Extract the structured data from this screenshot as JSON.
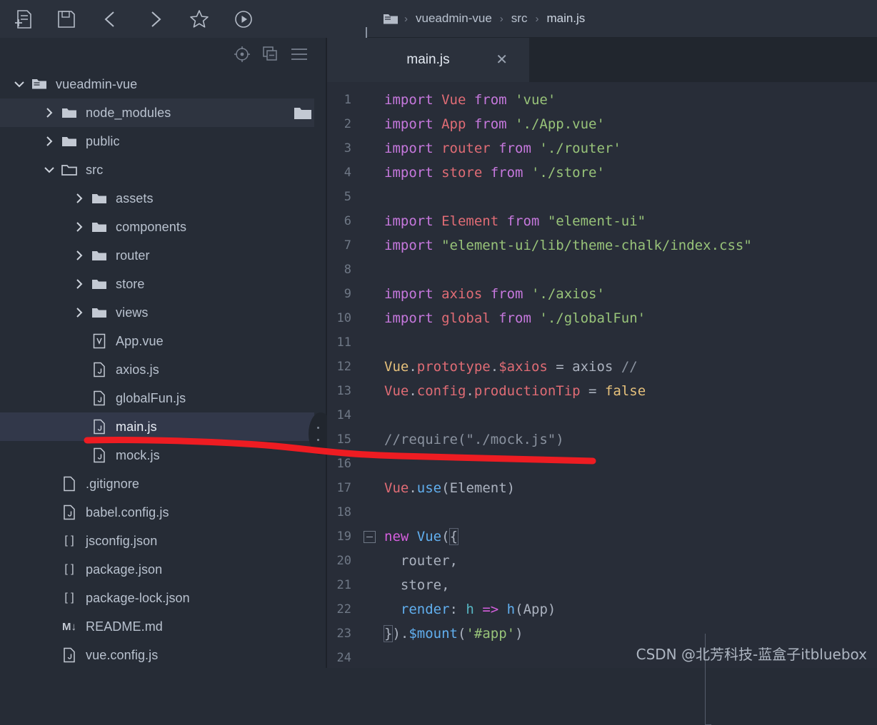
{
  "toolbar": {
    "buttons": [
      {
        "name": "new-file-icon",
        "label": "New File"
      },
      {
        "name": "save-icon",
        "label": "Save"
      },
      {
        "name": "back-arrow-icon",
        "label": "Back"
      },
      {
        "name": "forward-arrow-icon",
        "label": "Forward"
      },
      {
        "name": "star-icon",
        "label": "Bookmark"
      },
      {
        "name": "run-icon",
        "label": "Run"
      }
    ]
  },
  "breadcrumb": {
    "folder_icon": "folder-icon",
    "separator": "›",
    "items": [
      "vueadmin-vue",
      "src",
      "main.js"
    ]
  },
  "sidebar": {
    "tools": [
      {
        "name": "locate-target-icon"
      },
      {
        "name": "collapse-all-icon"
      },
      {
        "name": "menu-icon"
      }
    ],
    "tree": [
      {
        "label": "vueadmin-vue",
        "indent": 0,
        "arrow": "down",
        "icon": "project-folder-icon",
        "state": "normal"
      },
      {
        "label": "node_modules",
        "indent": 1,
        "arrow": "right",
        "icon": "folder-icon",
        "state": "selected",
        "trailing_icon": "folder-icon"
      },
      {
        "label": "public",
        "indent": 1,
        "arrow": "right",
        "icon": "folder-icon",
        "state": "normal"
      },
      {
        "label": "src",
        "indent": 1,
        "arrow": "down",
        "icon": "folder-open-icon",
        "state": "normal"
      },
      {
        "label": "assets",
        "indent": 2,
        "arrow": "right",
        "icon": "folder-icon",
        "state": "normal"
      },
      {
        "label": "components",
        "indent": 2,
        "arrow": "right",
        "icon": "folder-icon",
        "state": "normal"
      },
      {
        "label": "router",
        "indent": 2,
        "arrow": "right",
        "icon": "folder-icon",
        "state": "normal"
      },
      {
        "label": "store",
        "indent": 2,
        "arrow": "right",
        "icon": "folder-icon",
        "state": "normal"
      },
      {
        "label": "views",
        "indent": 2,
        "arrow": "right",
        "icon": "folder-icon",
        "state": "normal"
      },
      {
        "label": "App.vue",
        "indent": 2,
        "arrow": "none",
        "icon": "vue-file-icon",
        "state": "normal"
      },
      {
        "label": "axios.js",
        "indent": 2,
        "arrow": "none",
        "icon": "js-file-icon",
        "state": "normal"
      },
      {
        "label": "globalFun.js",
        "indent": 2,
        "arrow": "none",
        "icon": "js-file-icon",
        "state": "normal"
      },
      {
        "label": "main.js",
        "indent": 2,
        "arrow": "none",
        "icon": "js-file-icon",
        "state": "active"
      },
      {
        "label": "mock.js",
        "indent": 2,
        "arrow": "none",
        "icon": "js-file-icon",
        "state": "normal"
      },
      {
        "label": ".gitignore",
        "indent": 1,
        "arrow": "none",
        "icon": "plain-file-icon",
        "state": "normal"
      },
      {
        "label": "babel.config.js",
        "indent": 1,
        "arrow": "none",
        "icon": "js-file-icon",
        "state": "normal"
      },
      {
        "label": "jsconfig.json",
        "indent": 1,
        "arrow": "none",
        "icon": "json-file-icon",
        "state": "normal"
      },
      {
        "label": "package.json",
        "indent": 1,
        "arrow": "none",
        "icon": "json-file-icon",
        "state": "normal"
      },
      {
        "label": "package-lock.json",
        "indent": 1,
        "arrow": "none",
        "icon": "json-file-icon",
        "state": "normal"
      },
      {
        "label": "README.md",
        "indent": 1,
        "arrow": "none",
        "icon": "markdown-file-icon",
        "state": "normal"
      },
      {
        "label": "vue.config.js",
        "indent": 1,
        "arrow": "none",
        "icon": "js-file-icon",
        "state": "normal"
      }
    ]
  },
  "editor": {
    "tab": {
      "label": "main.js",
      "close": "✕"
    },
    "lines": [
      {
        "n": "1",
        "tokens": [
          {
            "t": "import ",
            "c": "kw"
          },
          {
            "t": "Vue",
            "c": "id"
          },
          {
            "t": " ",
            "c": "plain"
          },
          {
            "t": "from",
            "c": "kw"
          },
          {
            "t": " ",
            "c": "plain"
          },
          {
            "t": "'vue'",
            "c": "str"
          }
        ]
      },
      {
        "n": "2",
        "tokens": [
          {
            "t": "import ",
            "c": "kw"
          },
          {
            "t": "App",
            "c": "id"
          },
          {
            "t": " ",
            "c": "plain"
          },
          {
            "t": "from",
            "c": "kw"
          },
          {
            "t": " ",
            "c": "plain"
          },
          {
            "t": "'./App.vue'",
            "c": "str"
          }
        ]
      },
      {
        "n": "3",
        "tokens": [
          {
            "t": "import ",
            "c": "kw"
          },
          {
            "t": "router",
            "c": "id"
          },
          {
            "t": " ",
            "c": "plain"
          },
          {
            "t": "from",
            "c": "kw"
          },
          {
            "t": " ",
            "c": "plain"
          },
          {
            "t": "'./router'",
            "c": "str"
          }
        ]
      },
      {
        "n": "4",
        "tokens": [
          {
            "t": "import ",
            "c": "kw"
          },
          {
            "t": "store",
            "c": "id"
          },
          {
            "t": " ",
            "c": "plain"
          },
          {
            "t": "from",
            "c": "kw"
          },
          {
            "t": " ",
            "c": "plain"
          },
          {
            "t": "'./store'",
            "c": "str"
          }
        ]
      },
      {
        "n": "5",
        "tokens": []
      },
      {
        "n": "6",
        "tokens": [
          {
            "t": "import ",
            "c": "kw"
          },
          {
            "t": "Element",
            "c": "id"
          },
          {
            "t": " ",
            "c": "plain"
          },
          {
            "t": "from",
            "c": "kw"
          },
          {
            "t": " ",
            "c": "plain"
          },
          {
            "t": "\"element-ui\"",
            "c": "str"
          }
        ]
      },
      {
        "n": "7",
        "tokens": [
          {
            "t": "import ",
            "c": "kw"
          },
          {
            "t": "\"element-ui/lib/theme-chalk/index.css\"",
            "c": "str"
          }
        ]
      },
      {
        "n": "8",
        "tokens": []
      },
      {
        "n": "9",
        "tokens": [
          {
            "t": "import ",
            "c": "kw"
          },
          {
            "t": "axios",
            "c": "id"
          },
          {
            "t": " ",
            "c": "plain"
          },
          {
            "t": "from",
            "c": "kw"
          },
          {
            "t": " ",
            "c": "plain"
          },
          {
            "t": "'./axios'",
            "c": "str"
          }
        ]
      },
      {
        "n": "10",
        "tokens": [
          {
            "t": "import ",
            "c": "kw"
          },
          {
            "t": "global",
            "c": "id"
          },
          {
            "t": " ",
            "c": "plain"
          },
          {
            "t": "from",
            "c": "kw"
          },
          {
            "t": " ",
            "c": "plain"
          },
          {
            "t": "'./globalFun'",
            "c": "str"
          }
        ]
      },
      {
        "n": "11",
        "tokens": []
      },
      {
        "n": "12",
        "tokens": [
          {
            "t": "Vue",
            "c": "yellow"
          },
          {
            "t": ".",
            "c": "plain"
          },
          {
            "t": "prototype",
            "c": "id"
          },
          {
            "t": ".",
            "c": "plain"
          },
          {
            "t": "$axios",
            "c": "id"
          },
          {
            "t": " ",
            "c": "plain"
          },
          {
            "t": "=",
            "c": "op"
          },
          {
            "t": " axios ",
            "c": "plain"
          },
          {
            "t": "//",
            "c": "cm"
          }
        ]
      },
      {
        "n": "13",
        "tokens": [
          {
            "t": "Vue",
            "c": "id"
          },
          {
            "t": ".",
            "c": "plain"
          },
          {
            "t": "config",
            "c": "id"
          },
          {
            "t": ".",
            "c": "plain"
          },
          {
            "t": "productionTip",
            "c": "id"
          },
          {
            "t": " ",
            "c": "plain"
          },
          {
            "t": "=",
            "c": "op"
          },
          {
            "t": " ",
            "c": "plain"
          },
          {
            "t": "false",
            "c": "yellow"
          }
        ]
      },
      {
        "n": "14",
        "tokens": []
      },
      {
        "n": "15",
        "tokens": [
          {
            "t": "//require(\"./mock.js\")",
            "c": "cm"
          }
        ]
      },
      {
        "n": "16",
        "tokens": []
      },
      {
        "n": "17",
        "tokens": [
          {
            "t": "Vue",
            "c": "id"
          },
          {
            "t": ".",
            "c": "plain"
          },
          {
            "t": "use",
            "c": "blue"
          },
          {
            "t": "(",
            "c": "plain"
          },
          {
            "t": "Element",
            "c": "plain"
          },
          {
            "t": ")",
            "c": "plain"
          }
        ]
      },
      {
        "n": "18",
        "tokens": []
      },
      {
        "n": "19",
        "tokens": [
          {
            "t": "new",
            "c": "pink"
          },
          {
            "t": " ",
            "c": "plain"
          },
          {
            "t": "Vue",
            "c": "blue"
          },
          {
            "t": "(",
            "c": "plain"
          },
          {
            "t": "{",
            "c": "plain",
            "bracket": true
          }
        ],
        "fold": "open"
      },
      {
        "n": "20",
        "tokens": [
          {
            "t": "  router,",
            "c": "plain"
          }
        ],
        "guide": true
      },
      {
        "n": "21",
        "tokens": [
          {
            "t": "  store,",
            "c": "plain"
          }
        ],
        "guide": true
      },
      {
        "n": "22",
        "tokens": [
          {
            "t": "  ",
            "c": "plain"
          },
          {
            "t": "render",
            "c": "blue"
          },
          {
            "t": ": ",
            "c": "plain"
          },
          {
            "t": "h",
            "c": "lblue"
          },
          {
            "t": " ",
            "c": "plain"
          },
          {
            "t": "=>",
            "c": "pink"
          },
          {
            "t": " ",
            "c": "plain"
          },
          {
            "t": "h",
            "c": "blue"
          },
          {
            "t": "(",
            "c": "plain"
          },
          {
            "t": "App",
            "c": "plain"
          },
          {
            "t": ")",
            "c": "plain"
          }
        ],
        "guide": true
      },
      {
        "n": "23",
        "tokens": [
          {
            "t": "}",
            "c": "plain",
            "bracket": true
          },
          {
            "t": ")",
            "c": "plain"
          },
          {
            "t": ".",
            "c": "plain"
          },
          {
            "t": "$mount",
            "c": "blue"
          },
          {
            "t": "(",
            "c": "plain"
          },
          {
            "t": "'#app'",
            "c": "str"
          },
          {
            "t": ")",
            "c": "plain"
          }
        ],
        "guide": "end"
      },
      {
        "n": "24",
        "tokens": []
      }
    ]
  },
  "annotation": {
    "color": "#ee1c22",
    "type": "hand-drawn-underline"
  },
  "watermark": {
    "text": "CSDN @北芳科技-蓝盒子itbluebox"
  }
}
